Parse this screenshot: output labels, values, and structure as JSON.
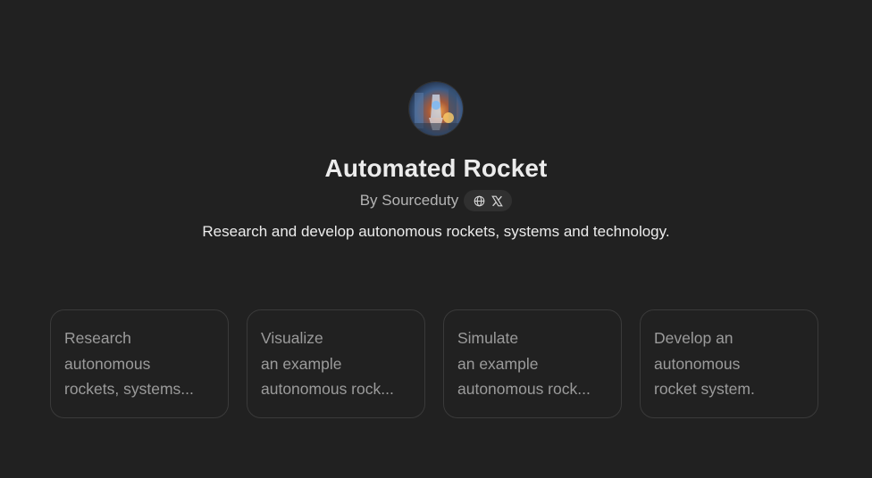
{
  "gpt": {
    "title": "Automated Rocket",
    "byline": "By Sourceduty",
    "description": "Research and develop autonomous rockets, systems and technology.",
    "social_icons": [
      "globe-icon",
      "x-logo-icon"
    ]
  },
  "starters": [
    {
      "line1": "Research",
      "line2": "autonomous",
      "line3": "rockets, systems..."
    },
    {
      "line1": "Visualize",
      "line2": "an example",
      "line3": "autonomous rock..."
    },
    {
      "line1": "Simulate",
      "line2": "an example",
      "line3": "autonomous rock..."
    },
    {
      "line1": "Develop an",
      "line2": "autonomous",
      "line3": "rocket system."
    }
  ],
  "colors": {
    "background": "#212121",
    "card_border": "#3a3a3a",
    "pill_background": "#303030",
    "muted_text": "#b4b4b4",
    "card_text": "#9b9b9b"
  }
}
